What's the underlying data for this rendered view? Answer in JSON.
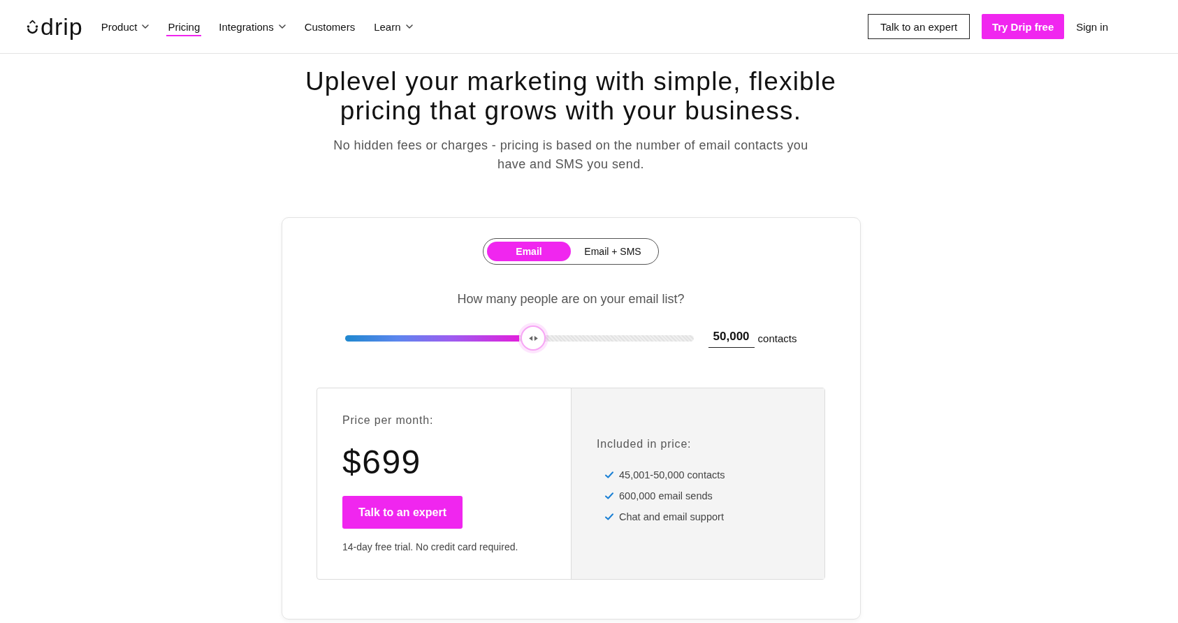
{
  "nav": {
    "logo": "drip",
    "links": [
      {
        "label": "Product",
        "dropdown": true,
        "selected": false
      },
      {
        "label": "Pricing",
        "dropdown": false,
        "selected": true
      },
      {
        "label": "Integrations",
        "dropdown": true,
        "selected": false
      },
      {
        "label": "Customers",
        "dropdown": false,
        "selected": false
      },
      {
        "label": "Learn",
        "dropdown": true,
        "selected": false
      }
    ],
    "actions": [
      {
        "label": "Talk to an expert",
        "kind": "outline"
      },
      {
        "label": "Try Drip free",
        "kind": "filled"
      },
      {
        "label": "Sign in",
        "kind": "link"
      }
    ]
  },
  "hero": {
    "title": "Uplevel your marketing with simple, flexible pricing that grows with your business.",
    "subtitle": "No hidden fees or charges - pricing is based on the number of email contacts you have and SMS you send."
  },
  "pricing": {
    "plan_tabs": [
      {
        "label": "Email",
        "selected": true
      },
      {
        "label": "Email + SMS",
        "selected": false
      }
    ],
    "question": "How many people are on your email list?",
    "slider": {
      "level": 0.54
    },
    "contacts_input": {
      "value": "50,000"
    },
    "contacts_unit": "contacts",
    "price_label": "Price per month:",
    "price": "$699",
    "cta": "Talk to an expert",
    "note": "14-day free trial. No credit card required.",
    "included_title": "Included in price:",
    "included": [
      "45,001-50,000 contacts",
      "600,000 email sends",
      "Chat and email support"
    ]
  }
}
